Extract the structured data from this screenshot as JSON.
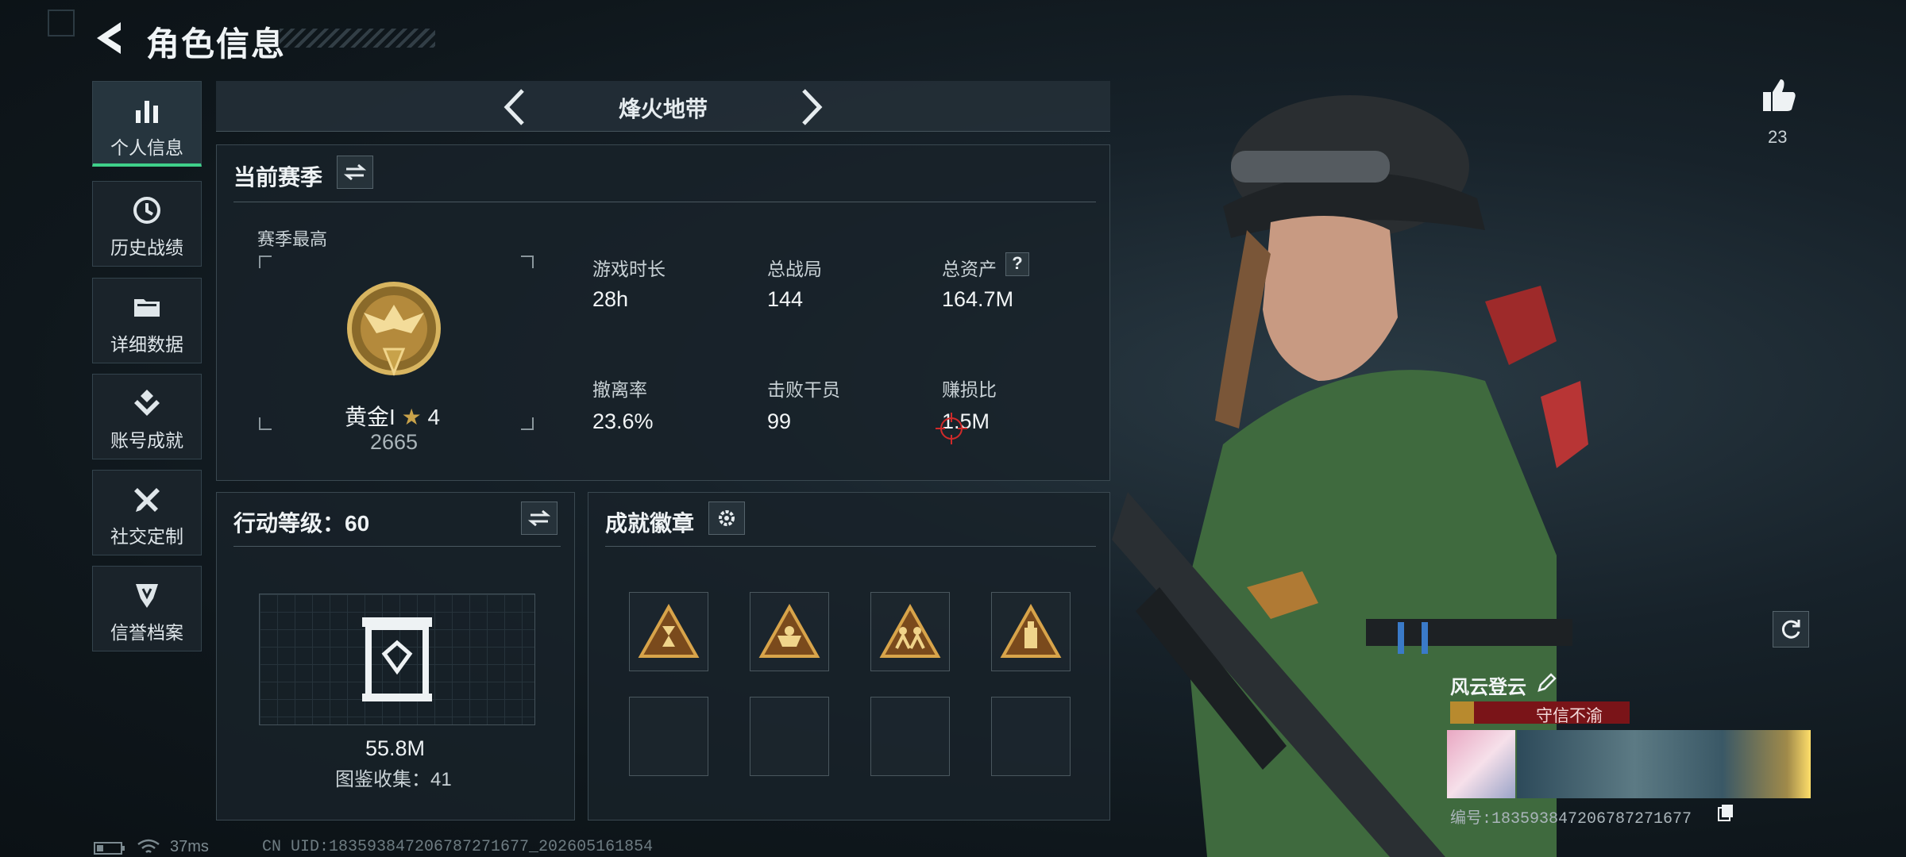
{
  "header": {
    "title": "角色信息"
  },
  "nav": [
    {
      "label": "个人信息",
      "icon": "bar-chart-icon",
      "active": true
    },
    {
      "label": "历史战绩",
      "icon": "history-icon"
    },
    {
      "label": "详细数据",
      "icon": "folder-icon"
    },
    {
      "label": "账号成就",
      "icon": "achievement-icon"
    },
    {
      "label": "社交定制",
      "icon": "tools-icon"
    },
    {
      "label": "信誉档案",
      "icon": "reputation-icon"
    }
  ],
  "mode_tab": {
    "name": "烽火地带"
  },
  "season": {
    "title": "当前赛季",
    "highest_label": "赛季最高",
    "rank_name": "黄金I",
    "rank_stars": "4",
    "rank_score": "2665",
    "stats": [
      {
        "label": "游戏时长",
        "value": "28h"
      },
      {
        "label": "总战局",
        "value": "144"
      },
      {
        "label": "总资产",
        "value": "164.7M"
      },
      {
        "label": "撤离率",
        "value": "23.6%"
      },
      {
        "label": "击败干员",
        "value": "99"
      },
      {
        "label": "赚损比",
        "value": "1.5M"
      }
    ],
    "help": "?"
  },
  "action_level": {
    "title": "行动等级：60",
    "value": "55.8M",
    "collection": "图鉴收集：41"
  },
  "achievements": {
    "title": "成就徽章",
    "badges": [
      "hourglass-badge-icon",
      "basket-badge-icon",
      "team-badge-icon",
      "bottle-badge-icon"
    ]
  },
  "likes": {
    "count": "23"
  },
  "player": {
    "name": "风云登云",
    "tag": "守信不渝",
    "id": "编号:1835938472067872716​77"
  },
  "footer": {
    "ping": "37ms",
    "uid": "CN UID:1835938472067872716​77_202605161854"
  },
  "colors": {
    "accent": "#3fd08a",
    "tag_red": "#7a1418",
    "gold": "#c8a24a"
  }
}
